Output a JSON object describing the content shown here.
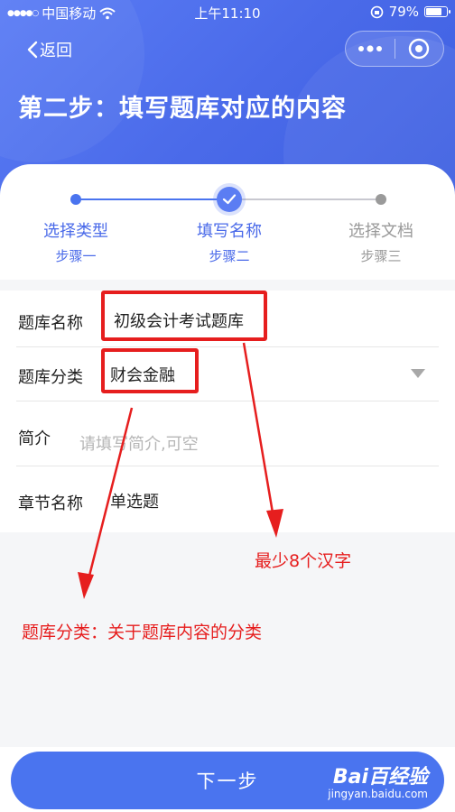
{
  "status_bar": {
    "carrier": "中国移动",
    "time": "上午11:10",
    "battery": "79%",
    "battery_level": 0.79
  },
  "nav": {
    "back_label": "返回",
    "page_title": "第二步：填写题库对应的内容"
  },
  "steps": [
    {
      "label": "选择类型",
      "sub": "步骤一",
      "state": "done"
    },
    {
      "label": "填写名称",
      "sub": "步骤二",
      "state": "current"
    },
    {
      "label": "选择文档",
      "sub": "步骤三",
      "state": "pending"
    }
  ],
  "form": {
    "name": {
      "label": "题库名称",
      "value": "初级会计考试题库"
    },
    "category": {
      "label": "题库分类",
      "value": "财会金融"
    },
    "intro": {
      "label": "简介",
      "placeholder": "请填写简介,可空"
    },
    "chapter": {
      "label": "章节名称",
      "value": "单选题"
    }
  },
  "annotations": {
    "min_chars": "最少8个汉字",
    "category_note": "题库分类：关于题库内容的分类"
  },
  "footer": {
    "next_label": "下一步",
    "watermark": "Bai百经验",
    "watermark_sub": "jingyan.baidu.com"
  },
  "colors": {
    "primary": "#4a74ef",
    "annotation_red": "#e61e1e",
    "step_label_blue": "#4a6ae9"
  }
}
